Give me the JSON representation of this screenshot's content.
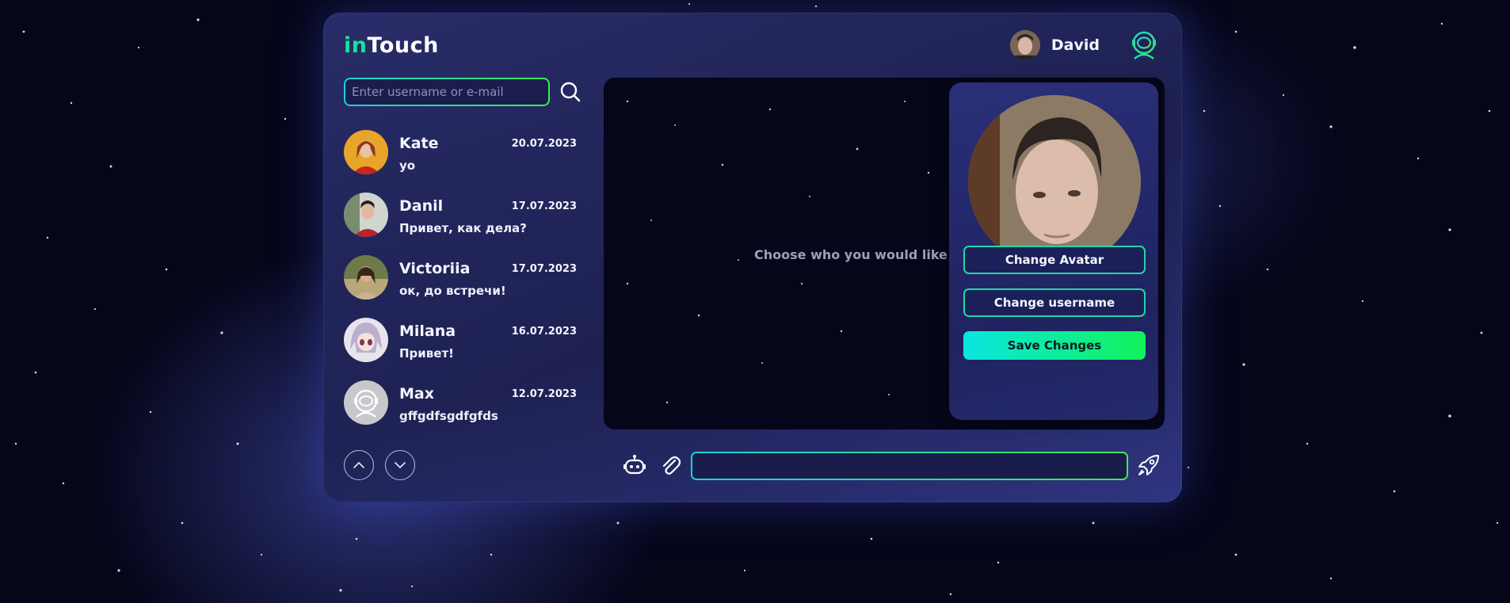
{
  "app": {
    "logo_prefix": "in",
    "logo_suffix": "Touch",
    "current_user": "David",
    "accent_gradient": [
      "#18d2d8",
      "#3ee856"
    ]
  },
  "search": {
    "placeholder": "Enter username or e-mail"
  },
  "chats": [
    {
      "name": "Kate",
      "date": "20.07.2023",
      "last_message": "yo"
    },
    {
      "name": "Danil",
      "date": "17.07.2023",
      "last_message": "Привет, как дела?"
    },
    {
      "name": "Victoriia",
      "date": "17.07.2023",
      "last_message": "ок, до встречи!"
    },
    {
      "name": "Milana",
      "date": "16.07.2023",
      "last_message": "Привет!"
    },
    {
      "name": "Max",
      "date": "12.07.2023",
      "last_message": "gffgdfsgdfgfds"
    }
  ],
  "chat_area": {
    "empty_text": "Choose who you would like to"
  },
  "profile_panel": {
    "change_avatar": "Change Avatar",
    "change_username": "Change username",
    "save_changes": "Save Changes"
  },
  "icons": {
    "search": "search-icon",
    "astronaut": "astronaut-icon",
    "up": "chevron-up-icon",
    "down": "chevron-down-icon",
    "bot": "robot-icon",
    "attach": "paperclip-icon",
    "send": "rocket-icon"
  }
}
